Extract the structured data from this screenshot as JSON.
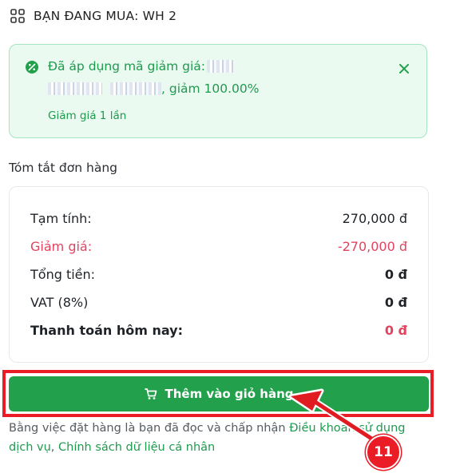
{
  "header": {
    "title": "BẠN ĐANG MUA: WH 2"
  },
  "coupon": {
    "applied_label": "Đã áp dụng mã giảm giá:",
    "discount_text": ", giảm 100.00%",
    "note": "Giảm giá 1 lần"
  },
  "summary": {
    "title": "Tóm tắt đơn hàng",
    "rows": [
      {
        "label": "Tạm tính:",
        "value": "270,000 đ"
      },
      {
        "label": "Giảm giá:",
        "value": "-270,000 đ"
      },
      {
        "label": "Tổng tiền:",
        "value": "0 đ"
      },
      {
        "label": "VAT (8%)",
        "value": "0 đ"
      },
      {
        "label": "Thanh toán hôm nay:",
        "value": "0 đ"
      }
    ]
  },
  "cta": {
    "label": "Thêm vào giỏ hàng"
  },
  "terms": {
    "prefix": "Bằng việc đặt hàng là bạn đã đọc và chấp nhận ",
    "link1": "Điều khoản sử dụng dịch vụ",
    "sep": ", ",
    "link2": "Chính sách dữ liệu cá nhân"
  },
  "annotation": {
    "step": "11"
  },
  "colors": {
    "primary_green": "#22a04b",
    "discount_red": "#e0445e",
    "highlight_red": "#ea1c25"
  },
  "icons": {
    "header": "grid-icon",
    "coupon": "badge-check-icon",
    "close": "close-icon",
    "cta": "cart-icon"
  }
}
